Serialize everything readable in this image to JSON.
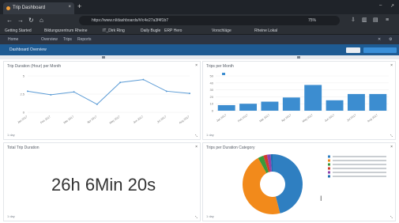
{
  "browser": {
    "tab_title": "Trip Dashboard",
    "tab_close": "×",
    "new_tab": "+",
    "win_min": "–",
    "win_max": "↗",
    "back": "←",
    "forward": "→",
    "reload": "↻",
    "home": "⌂",
    "url": "https://www.nl/dashboards/#/c4e27a3f4f1b7",
    "zoom": "75%",
    "bookmarks": [
      "Getting Started",
      "Bildungszentrum Rheine",
      "IT_Dirk Ring",
      "Daily Bugle",
      "ERP Hero",
      "Vorschläge",
      "Rheine Lokal"
    ]
  },
  "app": {
    "nav_items": [
      "Home",
      "Overview",
      "Trips",
      "Reports"
    ],
    "dashboard_title": "Dashboard Overview",
    "nav_icon_close": "✕",
    "nav_icon_settings": "⚙"
  },
  "panels": {
    "line": {
      "title": "Trip Duration (Hour) per Month",
      "footer": "1 day",
      "close": "×",
      "resize": "⤡"
    },
    "bar": {
      "title": "Trips per Month",
      "footer": "1 day",
      "close": "×",
      "resize": "⤡"
    },
    "total": {
      "title": "Total Trip Duration",
      "value": "26h 6Min 20s",
      "footer": "1 day",
      "close": "×",
      "resize": "⤡"
    },
    "donut": {
      "title": "Trips per Duration Category",
      "footer": "1 day",
      "close": "×",
      "resize": "⤡"
    }
  },
  "chart_data": [
    {
      "type": "line",
      "title": "Trip Duration (Hour) per Month",
      "categories": [
        "Jan 2017",
        "Feb 2017",
        "Mar 2017",
        "Apr 2017",
        "May 2017",
        "Jun 2017",
        "Jul 2017",
        "Aug 2017"
      ],
      "values": [
        2.9,
        2.4,
        2.8,
        1.1,
        4.1,
        4.5,
        2.9,
        2.6
      ],
      "ylim": [
        0,
        5
      ],
      "yticks": [
        "0",
        "2.5",
        "5"
      ],
      "color": "#5b9bd5"
    },
    {
      "type": "bar",
      "title": "Trips per Month",
      "categories": [
        "Jan 2017",
        "Feb 2017",
        "Mar 2017",
        "Apr 2017",
        "May 2017",
        "Jun 2017",
        "Jul 2017",
        "Aug 2017"
      ],
      "values": [
        8,
        10,
        13,
        19,
        37,
        15,
        24,
        24
      ],
      "ylim": [
        0,
        50
      ],
      "yticks": [
        "0",
        "10",
        "20",
        "30",
        "40",
        "50"
      ],
      "color": "#3c8dd0"
    },
    {
      "type": "pie",
      "title": "Trips per Duration Category",
      "labels": [
        "Category A",
        "Category B",
        "Category C",
        "Category D",
        "Category E",
        "Category F"
      ],
      "values": [
        46,
        46,
        3,
        2,
        2,
        1
      ],
      "colors": [
        "#2f7fc1",
        "#f28a1b",
        "#3a9a3a",
        "#d13b2e",
        "#8e44ad",
        "#1f6fb0"
      ]
    }
  ]
}
